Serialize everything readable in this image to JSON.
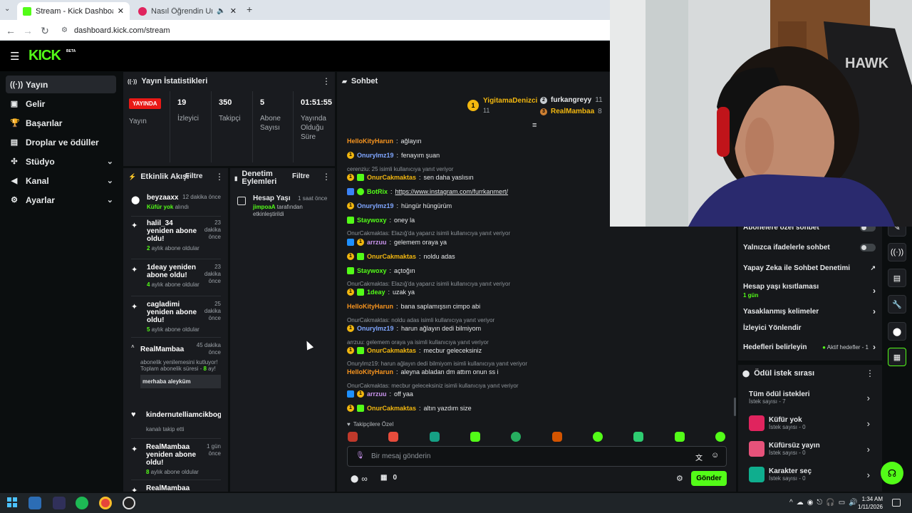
{
  "browser": {
    "tabs": [
      {
        "title": "Stream - Kick Dashboard",
        "active": true
      },
      {
        "title": "Nasıl Öğrendin Unutmayı -",
        "active": false
      }
    ],
    "url": "dashboard.kick.com/stream"
  },
  "brand": {
    "logo": "KICK",
    "beta": "BETA",
    "accent": "#53fc18"
  },
  "sidebar": {
    "items": [
      {
        "label": "Yayın",
        "icon": "broadcast-icon",
        "active": true,
        "expandable": false
      },
      {
        "label": "Gelir",
        "icon": "wallet-icon",
        "active": false,
        "expandable": false
      },
      {
        "label": "Başarılar",
        "icon": "trophy-icon",
        "active": false,
        "expandable": false
      },
      {
        "label": "Droplar ve ödüller",
        "icon": "gift-icon",
        "active": false,
        "expandable": false
      },
      {
        "label": "Stüdyo",
        "icon": "studio-icon",
        "active": false,
        "expandable": true
      },
      {
        "label": "Kanal",
        "icon": "megaphone-icon",
        "active": false,
        "expandable": true
      },
      {
        "label": "Ayarlar",
        "icon": "gear-icon",
        "active": false,
        "expandable": true
      }
    ]
  },
  "stats": {
    "title": "Yayın İstatistikleri",
    "live_badge": "YAYINDA",
    "live_label": "Yayın",
    "items": [
      {
        "value": "19",
        "label": "İzleyici"
      },
      {
        "value": "350",
        "label": "Takipçi"
      },
      {
        "value": "5",
        "label": "Abone Sayısı"
      },
      {
        "value": "01:51:55",
        "label": "Yayında Olduğu Süre"
      }
    ]
  },
  "activity": {
    "title": "Etkinlik Akışı",
    "filter": "Filtre",
    "events": [
      {
        "title": "beyzaaxx",
        "time": "12 dakika önce",
        "sub_green": "Küfür yok",
        "sub": " alındı",
        "icon": "reward-icon"
      },
      {
        "title": "halil_34 yeniden abone oldu!",
        "time": "23 dakika önce",
        "sub_green": "2",
        "sub": " aylık abone oldular",
        "icon": "sparkle-icon"
      },
      {
        "title": "1deay yeniden abone oldu!",
        "time": "23 dakika önce",
        "sub_green": "4",
        "sub": " aylık abone oldular",
        "icon": "sparkle-icon"
      },
      {
        "title": "cagladimi yeniden abone oldu!",
        "time": "25 dakika önce",
        "sub_green": "5",
        "sub": " aylık abone oldular",
        "icon": "sparkle-icon"
      },
      {
        "title": "RealMambaa",
        "time": "45 dakika önce",
        "sub_pre": "abonelik yenilemesini kutluyor! Toplam abonelik süresi - ",
        "sub_green": "8",
        "sub": " ay!",
        "message": "merhaba aleyküm",
        "icon": "caret-icon"
      },
      {
        "title": "kindernutelliamcikboga",
        "time": "",
        "sub": "kanalı takip etti",
        "icon": "heart-icon"
      },
      {
        "title": "RealMambaa yeniden abone oldu!",
        "time": "1 gün önce",
        "sub_green": "8",
        "sub": " aylık abone oldular",
        "icon": "sparkle-icon"
      },
      {
        "title": "RealMambaa",
        "time": "",
        "sub": "",
        "icon": "sparkle-icon"
      }
    ]
  },
  "moderation": {
    "title": "Denetim Eylemleri",
    "filter": "Filtre",
    "action_title": "Hesap Yaşı",
    "time": "1 saat önce",
    "user": "jimpoaA",
    "desc": " tarafından etkinleştirildi"
  },
  "chat": {
    "title": "Sohbet",
    "top": [
      {
        "name": "YigitamaDenizci",
        "count": "11",
        "rank": "1"
      },
      {
        "name": "furkangreyy",
        "count": "11",
        "rank": "2"
      },
      {
        "name": "RealMambaa",
        "count": "8",
        "rank": "3"
      }
    ],
    "messages": [
      {
        "user": "HelloKityHarun",
        "color": "#f7941e",
        "text": "ağlayın"
      },
      {
        "user": "Onurylmz19",
        "color": "#7fa6ff",
        "text": "fenayım şuan",
        "badge": "1"
      },
      {
        "reply": "cerenziu: 25 isimli kullanıcıya yanıt veriyor",
        "user": "OnurCakmaktas",
        "color": "#f2b70f",
        "text": "sen daha yaslısın",
        "badge": "1",
        "gbadge": true
      },
      {
        "user": "BotRix",
        "color": "#53fc18",
        "text": "https://www.instagram.com/furrkanmert/",
        "link": true,
        "bot": true
      },
      {
        "user": "Onurylmz19",
        "color": "#7fa6ff",
        "text": "hüngür hüngürüm",
        "badge": "1"
      },
      {
        "user": "Staywoxy",
        "color": "#53fc18",
        "text": "oney la",
        "gbadge": true
      },
      {
        "reply": "OnurCakmaktas: Elazığ'da yaparız isimli kullanıcıya yanıt veriyor",
        "user": "arrzuu",
        "color": "#c792ea",
        "text": "gelemem oraya ya",
        "badge": "1",
        "gbadge": true
      },
      {
        "user": "OnurCakmaktas",
        "color": "#f2b70f",
        "text": "noldu adas",
        "badge": "1",
        "gbadge": true
      },
      {
        "user": "Staywoxy",
        "color": "#53fc18",
        "text": "açtoğın",
        "gbadge": true
      },
      {
        "reply": "OnurCakmaktas: Elazığ'da yaparız isimli kullanıcıya yanıt veriyor",
        "user": "1deay",
        "color": "#53fc18",
        "text": "uzak ya",
        "badge": "1",
        "gbadge": true
      },
      {
        "user": "HelloKityHarun",
        "color": "#f7941e",
        "text": "bana saplamışsın cimpo abi"
      },
      {
        "reply": "OnurCakmaktas: noldu adas isimli kullanıcıya yanıt veriyor",
        "user": "Onurylmz19",
        "color": "#7fa6ff",
        "text": "harun ağlayın dedi bilmiyom",
        "badge": "1"
      },
      {
        "reply": "arrzuu: gelemem oraya ya isimli kullanıcıya yanıt veriyor",
        "user": "OnurCakmaktas",
        "color": "#f2b70f",
        "text": "mecbur geleceksiniz",
        "badge": "1",
        "gbadge": true
      },
      {
        "reply": "Onurylmz19: harun ağlayın dedi bilmiyom isimli kullanıcıya yanıt veriyor",
        "user": "HelloKityHarun",
        "color": "#f7941e",
        "text": "aleyna abladan dm attım onun ss i"
      },
      {
        "reply": "OnurCakmaktas: mecbur geleceksiniz isimli kullanıcıya yanıt veriyor",
        "user": "arrzuu",
        "color": "#c792ea",
        "text": "off yaa",
        "badge": "1",
        "gbadge": true
      },
      {
        "user": "OnurCakmaktas",
        "color": "#f2b70f",
        "text": "altın yazdım size",
        "badge": "1",
        "gbadge": true
      }
    ],
    "follower_only": "Takipçilere Özel",
    "placeholder": "Bir mesaj gönderin",
    "send": "Gönder",
    "points": "∞",
    "gifts": "0"
  },
  "settings": {
    "items": [
      {
        "label": "Abonelere özel sohbet",
        "type": "toggle"
      },
      {
        "label": "Yalnızca ifadelerle sohbet",
        "type": "toggle"
      },
      {
        "label": "Yapay Zeka ile Sohbet Denetimi",
        "type": "external"
      },
      {
        "label": "Hesap yaşı kısıtlaması",
        "sub": "1 gün",
        "type": "arrow"
      },
      {
        "label": "Yasaklanmış kelimeler",
        "type": "arrow"
      },
      {
        "label": "İzleyici Yönlendir",
        "type": "none"
      },
      {
        "label": "Hedefleri belirleyin",
        "status": "Aktif hedefler - 1",
        "type": "arrow"
      }
    ]
  },
  "rewards": {
    "title": "Ödül istek sırası",
    "items": [
      {
        "title": "Tüm ödül istekleri",
        "sub": "İstek sayısı - 7",
        "color": ""
      },
      {
        "title": "Küfür yok",
        "sub": "İstek sayısı - 0",
        "color": "#e0245e"
      },
      {
        "title": "Küfürsüz yayın",
        "sub": "İstek sayısı - 0",
        "color": "#e6527a"
      },
      {
        "title": "Karakter seç",
        "sub": "İstek sayısı - 0",
        "color": "#0fae8e"
      }
    ]
  },
  "taskbar": {
    "time": "1:34 AM",
    "date": "1/11/2026"
  }
}
